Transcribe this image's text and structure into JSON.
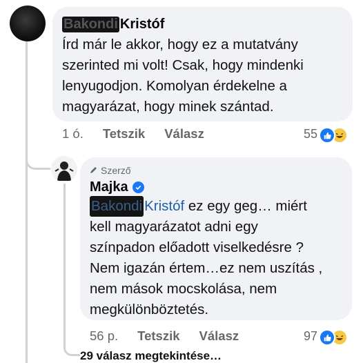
{
  "comment1": {
    "author_censored": "Bakondi",
    "author_name": "Kristóf",
    "text_lines": [
      "Írd már le akkor, hogy ez a mutatvány",
      "szerinted mi volt! Csak, hogy mindenki",
      "lenyugodjon. Komolyan érdekelne a",
      "magyarázat, hogy minek szántad."
    ],
    "time": "1 ó.",
    "like_label": "Tetszik",
    "reply_label": "Válasz",
    "reaction_count": "55"
  },
  "comment2": {
    "role_label": "Szerző",
    "author_name": "Majka",
    "mention_censored": "Bakondi",
    "mention_name": "Kristóf",
    "text_first_line": "ez egy geg… miért",
    "text_lines": [
      "kell magyarázatot adni egy",
      "színpadon előadott viselkedésre ?",
      "Nem igazán értem…ez nem uszítás ,",
      "nem mások mocskolása, nem",
      "megkülönböztetés."
    ],
    "time": "56 p.",
    "like_label": "Tetszik",
    "reply_label": "Válasz",
    "reaction_count": "97"
  },
  "more_replies_label": "29 válasz megtekintése…",
  "icons": {
    "like": "like-icon",
    "haha": "haha-icon",
    "verified": "verified-badge-icon",
    "author_role": "pencil-icon"
  },
  "colors": {
    "bubble": "#f0f2f5",
    "mention": "#1b5fa8",
    "like_blue": "#1877f2",
    "haha_yellow": "#f7c844",
    "meta_gray": "#65676b"
  }
}
